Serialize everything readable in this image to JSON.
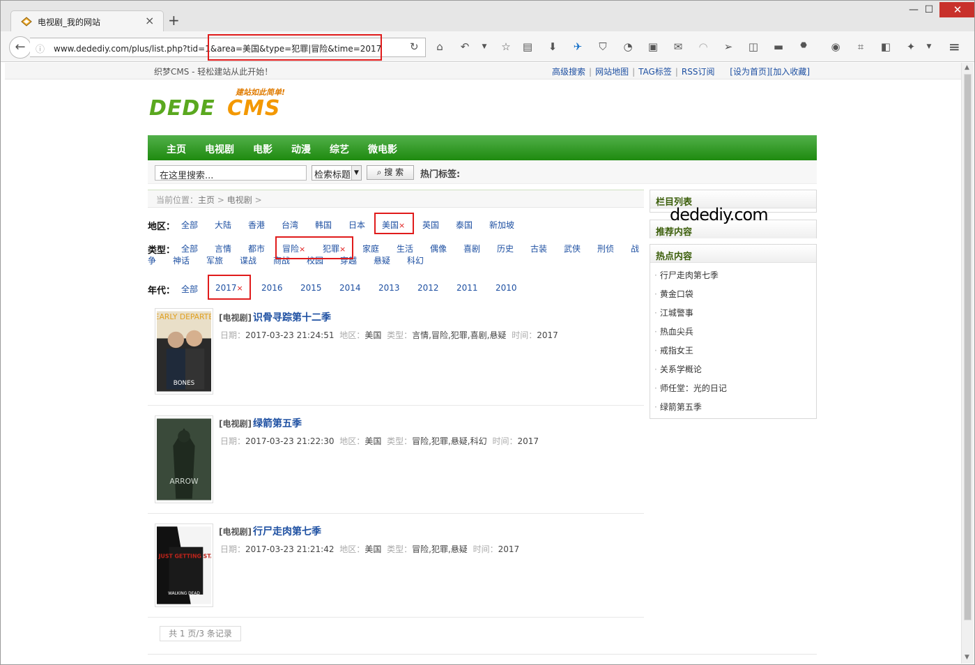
{
  "browser": {
    "tab_title": "电视剧_我的网站",
    "url": "www.dedediy.com/plus/list.php?tid=1&area=美国&type=犯罪|冒险&time=2017"
  },
  "site": {
    "slogan": "织梦CMS - 轻松建站从此开始！",
    "top_links": [
      "高级搜索",
      "网站地图",
      "TAG标签",
      "RSS订阅"
    ],
    "set_home": "[设为首页]",
    "add_fav": "[加入收藏]",
    "logo_tagline": "建站如此简单!",
    "logo_dede": "DEDE",
    "logo_cms": "CMS"
  },
  "menu": [
    "主页",
    "电视剧",
    "电影",
    "动漫",
    "综艺",
    "微电影"
  ],
  "search": {
    "placeholder": "在这里搜索...",
    "select_value": "检索标题",
    "button": "搜 索",
    "hot_label": "热门标签:"
  },
  "breadcrumb": {
    "label": "当前位置：",
    "home": "主页",
    "sep": ">",
    "current": "电视剧"
  },
  "filters": {
    "area": {
      "label": "地区：",
      "items": [
        "全部",
        "大陆",
        "香港",
        "台湾",
        "韩国",
        "日本",
        "美国",
        "英国",
        "泰国",
        "新加坡"
      ]
    },
    "type": {
      "label": "类型：",
      "items": [
        "全部",
        "言情",
        "都市",
        "冒险",
        "犯罪",
        "家庭",
        "生活",
        "偶像",
        "喜剧",
        "历史",
        "古装",
        "武侠",
        "刑侦",
        "战争",
        "神话",
        "军旅",
        "谍战",
        "商战",
        "校园",
        "穿越",
        "悬疑",
        "科幻"
      ]
    },
    "time": {
      "label": "年代：",
      "items": [
        "全部",
        "2017",
        "2016",
        "2015",
        "2014",
        "2013",
        "2012",
        "2011",
        "2010"
      ]
    },
    "remove_mark": "×"
  },
  "list": [
    {
      "cat": "[电视剧]",
      "title": "识骨寻踪第十二季",
      "date": "2017-03-23 21:24:51",
      "area": "美国",
      "type": "言情,冒险,犯罪,喜剧,悬疑",
      "time": "2017",
      "poster_text": "NEARLY DEPARTED",
      "poster_sub": "BONES"
    },
    {
      "cat": "[电视剧]",
      "title": "绿箭第五季",
      "date": "2017-03-23 21:22:30",
      "area": "美国",
      "type": "冒险,犯罪,悬疑,科幻",
      "time": "2017",
      "poster_text": "ARROW",
      "poster_sub": ""
    },
    {
      "cat": "[电视剧]",
      "title": "行尸走肉第七季",
      "date": "2017-03-23 21:21:42",
      "area": "美国",
      "type": "冒险,犯罪,悬疑",
      "time": "2017",
      "poster_text": "WE'RE JUST GETTING STARTED",
      "poster_sub": "WALKING DEAD"
    }
  ],
  "meta_labels": {
    "date": "日期：",
    "area": "地区：",
    "type": "类型：",
    "time": "时间："
  },
  "pager": "共 1 页/3 条记录",
  "sidebar": {
    "cols_title": "栏目列表",
    "rec_title": "推荐内容",
    "hot_title": "热点内容",
    "hot_items": [
      "行尸走肉第七季",
      "黄金口袋",
      "江城警事",
      "热血尖兵",
      "戒指女王",
      "关系学概论",
      "师任堂：光的日记",
      "绿箭第五季"
    ]
  },
  "watermark": "dedediy.com",
  "colors": {
    "accent_green": "#1e8a0f",
    "link_blue": "#1e50a2",
    "highlight_red": "#e01b1b"
  }
}
